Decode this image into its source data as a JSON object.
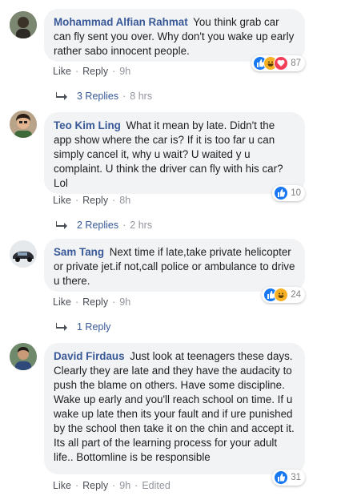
{
  "comments": [
    {
      "author": "Mohammad Alfian Rahmat",
      "text": "You think grab car can fly sent you over. Why don't you wake up early rather sabo innocent people.",
      "actions": {
        "like": "Like",
        "reply": "Reply",
        "time": "9h"
      },
      "reactions": {
        "icons": [
          "like-icon",
          "haha-icon",
          "love-icon"
        ],
        "count": "87"
      },
      "replies": {
        "label": "3 Replies",
        "time": "8 hrs"
      }
    },
    {
      "author": "Teo Kim Ling",
      "text": "What it mean by late. Didn't the app show where the car is? If it is too far u can simply cancel it, why u wait? U waited y u complaint. U think the driver can fly with his car? Lol",
      "actions": {
        "like": "Like",
        "reply": "Reply",
        "time": "8h"
      },
      "reactions": {
        "icons": [
          "like-icon"
        ],
        "count": "10"
      },
      "replies": {
        "label": "2 Replies",
        "time": "2 hrs"
      }
    },
    {
      "author": "Sam Tang",
      "text": "Next time if late,take private helicopter or private jet.if not,call police or ambulance to drive u there.",
      "actions": {
        "like": "Like",
        "reply": "Reply",
        "time": "9h"
      },
      "reactions": {
        "icons": [
          "like-icon",
          "haha-icon"
        ],
        "count": "24"
      },
      "replies": {
        "label": "1 Reply",
        "time": ""
      }
    },
    {
      "author": "David Firdaus",
      "text": "Just look at teenagers these days. Clearly they are late and they have the audacity to push the blame on others. Have some discipline. Wake up early and you'll reach school on time. If u wake up late then its your fault and if ure punished by the school then take it on the chin and accept it. Its all part of the learning process for your adult life.. Bottomline is be responsible",
      "actions": {
        "like": "Like",
        "reply": "Reply",
        "time": "9h",
        "edited": "Edited"
      },
      "reactions": {
        "icons": [
          "like-icon"
        ],
        "count": "31"
      }
    }
  ],
  "colors": {
    "author": "#385898",
    "bubble": "#f2f3f5",
    "like": "#1877f2",
    "haha": "#f7b125",
    "love": "#f33e58"
  }
}
